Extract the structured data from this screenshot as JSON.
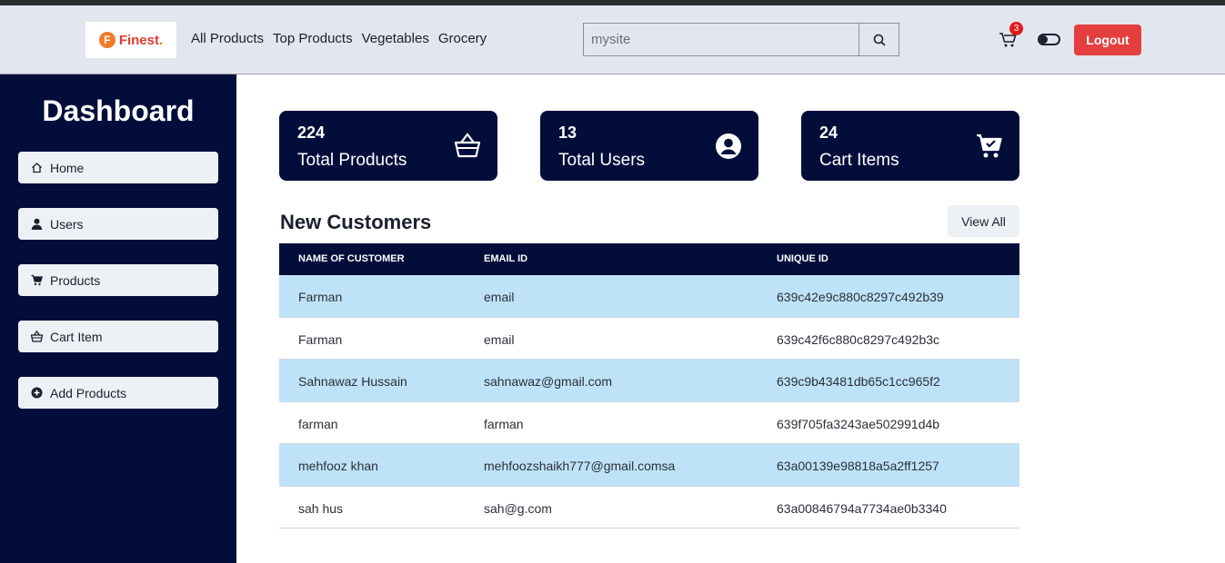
{
  "navbar": {
    "logo_text": "Finest",
    "logo_mark": "F",
    "links": [
      "All Products",
      "Top Products",
      "Vegetables",
      "Grocery"
    ],
    "search_value": "mysite",
    "cart_count": "3",
    "logout_label": "Logout",
    "icons": [
      "search-icon",
      "cart-icon",
      "theme-toggle"
    ]
  },
  "sidebar": {
    "title": "Dashboard",
    "items": [
      {
        "label": "Home",
        "icon": "home-icon"
      },
      {
        "label": "Users",
        "icon": "user-icon"
      },
      {
        "label": "Products",
        "icon": "cart-icon"
      },
      {
        "label": "Cart Item",
        "icon": "basket-icon"
      },
      {
        "label": "Add Products",
        "icon": "plus-circle-icon"
      }
    ]
  },
  "stats": [
    {
      "value": "224",
      "label": "Total Products",
      "icon": "basket-icon"
    },
    {
      "value": "13",
      "label": "Total Users",
      "icon": "user-circle-icon"
    },
    {
      "value": "24",
      "label": "Cart Items",
      "icon": "cart-check-icon"
    }
  ],
  "customers": {
    "title": "New Customers",
    "view_all_label": "View All",
    "headers": [
      "NAME OF CUSTOMER",
      "EMAIL ID",
      "UNIQUE ID"
    ],
    "rows": [
      [
        "Farman",
        "email",
        "639c42e9c880c8297c492b39"
      ],
      [
        "Farman",
        "email",
        "639c42f6c880c8297c492b3c"
      ],
      [
        "Sahnawaz Hussain",
        "sahnawaz@gmail.com",
        "639c9b43481db65c1cc965f2"
      ],
      [
        "farman",
        "farman",
        "639f705fa3243ae502991d4b"
      ],
      [
        "mehfooz khan",
        "mehfoozshaikh777@gmail.comsa",
        "63a00139e98818a5a2ff1257"
      ],
      [
        "sah hus",
        "sah@g.com",
        "63a00846794a7734ae0b3340"
      ]
    ]
  },
  "colors": {
    "navy": "#020d3a",
    "accent_red": "#e53e3e",
    "row_highlight": "#bee3f8"
  }
}
